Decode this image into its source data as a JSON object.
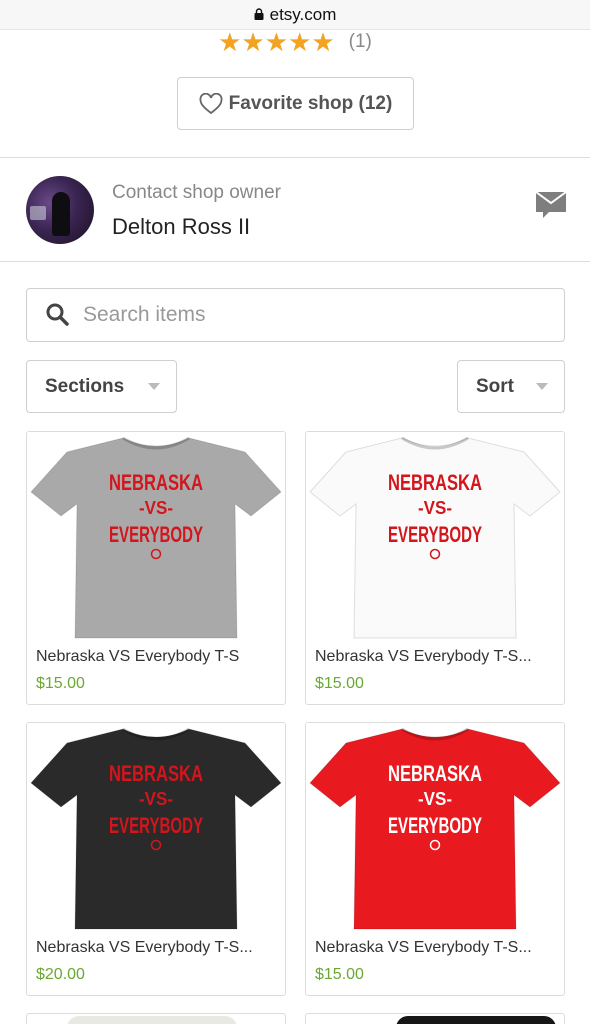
{
  "browser": {
    "domain": "etsy.com"
  },
  "shop": {
    "stars": "★★★★★",
    "rating_count": "(1)",
    "favorite_label": "Favorite shop (12)"
  },
  "owner": {
    "contact_label": "Contact shop owner",
    "name": "Delton Ross II"
  },
  "search": {
    "placeholder": "Search items",
    "value": ""
  },
  "filters": {
    "sections_label": "Sections",
    "sort_label": "Sort"
  },
  "listings": [
    {
      "title": "Nebraska VS Everybody T-S",
      "price": "$15.00",
      "shirt_color": "#a9a9a9",
      "print_color": "#d3151c",
      "shirt_lines": [
        "NEBRASKA",
        "-VS-",
        "EVERYBODY"
      ]
    },
    {
      "title": "Nebraska VS Everybody T-S...",
      "price": "$15.00",
      "shirt_color": "#fafafa",
      "print_color": "#d3151c",
      "shirt_lines": [
        "NEBRASKA",
        "-VS-",
        "EVERYBODY"
      ]
    },
    {
      "title": "Nebraska VS Everybody T-S...",
      "price": "$20.00",
      "shirt_color": "#2a2a2a",
      "print_color": "#d3151c",
      "shirt_lines": [
        "NEBRASKA",
        "-VS-",
        "EVERYBODY"
      ]
    },
    {
      "title": "Nebraska VS Everybody T-S...",
      "price": "$15.00",
      "shirt_color": "#e8191f",
      "print_color": "#ffffff",
      "shirt_lines": [
        "NEBRASKA",
        "-VS-",
        "EVERYBODY"
      ]
    }
  ],
  "colors": {
    "accent_star": "#f1a321",
    "price_green": "#6aa832"
  }
}
